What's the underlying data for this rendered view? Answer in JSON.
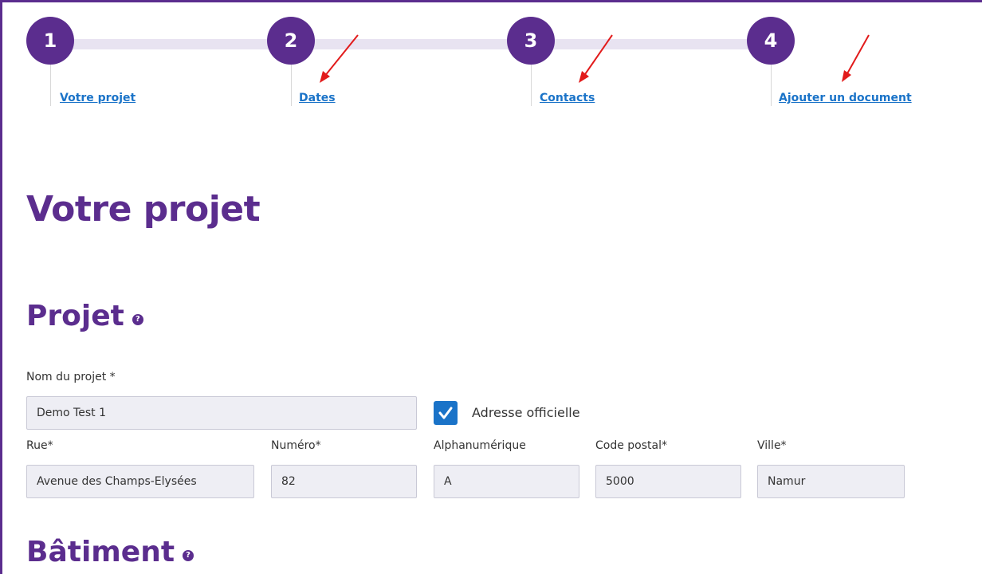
{
  "stepper": {
    "steps": [
      {
        "number": "1",
        "label": "Votre projet"
      },
      {
        "number": "2",
        "label": "Dates"
      },
      {
        "number": "3",
        "label": "Contacts"
      },
      {
        "number": "4",
        "label": "Ajouter un document"
      }
    ]
  },
  "page_title": "Votre projet",
  "sections": {
    "projet": {
      "title": "Projet"
    },
    "batiment": {
      "title": "Bâtiment"
    }
  },
  "form": {
    "project_name": {
      "label": "Nom du projet *",
      "value": "Demo Test 1"
    },
    "official_address": {
      "label": "Adresse officielle",
      "checked": true
    },
    "street": {
      "label": "Rue*",
      "value": "Avenue des Champs-Elysées"
    },
    "number": {
      "label": "Numéro*",
      "value": "82"
    },
    "alphanumeric": {
      "label": "Alphanumérique",
      "value": "A"
    },
    "postal_code": {
      "label": "Code postal*",
      "value": "5000"
    },
    "city": {
      "label": "Ville*",
      "value": "Namur"
    }
  },
  "colors": {
    "brand": "#5b2d8e",
    "link": "#1a73c8",
    "annotation_arrow": "#e21b1b"
  },
  "icons": {
    "help": "question-circle-icon",
    "check": "check-icon",
    "annotation": "red-arrow-annotation"
  }
}
